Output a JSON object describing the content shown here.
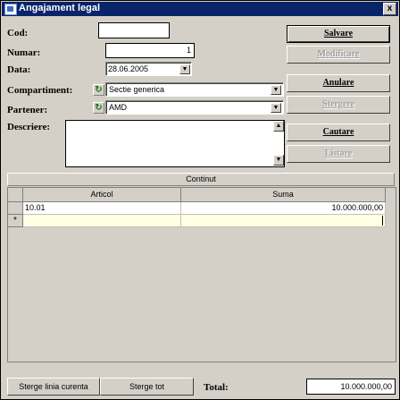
{
  "window": {
    "title": "Angajament legal",
    "close_glyph": "x",
    "icon": "app-icon"
  },
  "form": {
    "cod_label": "Cod:",
    "cod_value": "",
    "numar_label": "Numar:",
    "numar_value": "1",
    "data_label": "Data:",
    "data_value": "28.06.2005",
    "compartiment_label": "Compartiment:",
    "compartiment_value": "Sectie generica",
    "partener_label": "Partener:",
    "partener_value": "AMD",
    "descriere_label": "Descriere:",
    "descriere_value": ""
  },
  "buttons": {
    "salvare": "Salvare",
    "modificare": "Modificare",
    "anulare": "Anulare",
    "stergere": "Stergere",
    "cautare": "Cautare",
    "listare": "Listare"
  },
  "content_tab": "Continut",
  "table": {
    "columns": [
      "Articol",
      "Suma"
    ],
    "rows": [
      {
        "articol": "10.01",
        "suma": "10.000.000,00"
      }
    ],
    "new_row_marker": "*"
  },
  "bottom": {
    "sterge_linia": "Sterge linia curenta",
    "sterge_tot": "Sterge tot",
    "total_label": "Total:",
    "total_value": "10.000.000,00"
  },
  "icons": {
    "refresh": "refresh-icon",
    "dropdown": "chevron-down-icon",
    "scroll_up": "scroll-up-icon",
    "scroll_down": "scroll-down-icon"
  },
  "colors": {
    "titlebar": "#0a246a",
    "face": "#d4d0c8",
    "editing_cell": "#ffffe1"
  }
}
